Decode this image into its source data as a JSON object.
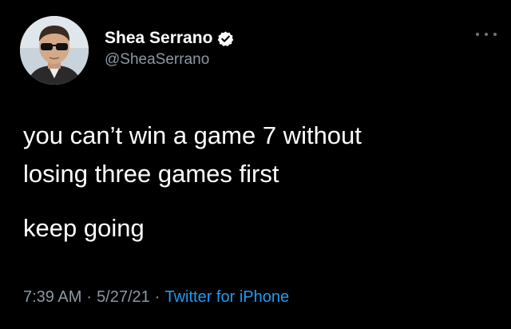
{
  "tweet": {
    "author": {
      "display_name": "Shea Serrano",
      "handle": "@SheaSerrano",
      "verified": true,
      "avatar_icon": "profile-photo"
    },
    "menu_icon": "more-options-icon",
    "text": {
      "line1": "you can’t win a game 7 without",
      "line2": "losing three games first",
      "line3": "keep going"
    },
    "meta": {
      "time": "7:39 AM",
      "separator": "·",
      "date": "5/27/21",
      "source": "Twitter for iPhone"
    }
  },
  "colors": {
    "background": "#000000",
    "text": "#ffffff",
    "muted": "#8b98a5",
    "link": "#1d9bf0"
  }
}
